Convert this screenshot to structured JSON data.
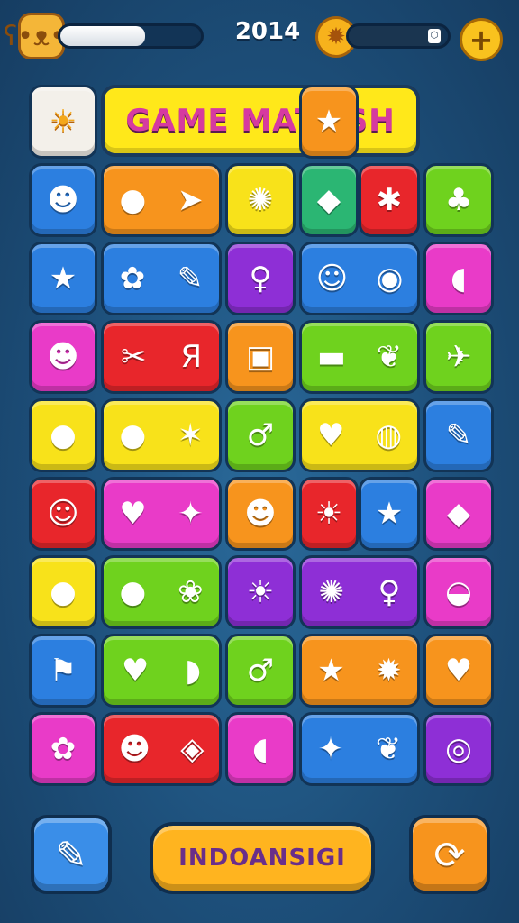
{
  "hud": {
    "score": "2014",
    "progress_left": 0.6,
    "progress_right": 0.95,
    "avatar_icon": "ʕ•ᴥ•ʔ",
    "coin_icon": "✹",
    "plus_label": "+"
  },
  "title": "GAME MATЦSH",
  "bottom": {
    "center_label": "INDOANSIGI",
    "left_icon": "✎",
    "right_icon": "⟳"
  },
  "colors": {
    "yellow": "#f8e21a",
    "orange": "#f7941d",
    "blue": "#2c7fe0",
    "green": "#6fd21e",
    "pink": "#e93bc8",
    "red": "#e8262b",
    "purple": "#8e2fd6",
    "white": "#f3f0ea",
    "teal": "#2bb673"
  },
  "tiles": [
    {
      "row": 0,
      "c": 0,
      "span": 1,
      "color": "white",
      "icons": [
        "☀"
      ]
    },
    {
      "row": 0,
      "c": 4,
      "span": 1,
      "color": "orange",
      "icons": [
        "★"
      ]
    },
    {
      "row": 1,
      "c": 0,
      "span": 1,
      "color": "blue",
      "icons": [
        "☻"
      ]
    },
    {
      "row": 1,
      "c": 1,
      "span": 2,
      "color": "orange",
      "icons": [
        "●",
        "➤"
      ]
    },
    {
      "row": 1,
      "c": 3,
      "span": 1,
      "color": "yellow",
      "icons": [
        "✺"
      ]
    },
    {
      "row": 1,
      "c": 4,
      "span": 1,
      "color": "teal",
      "icons": [
        "◆"
      ]
    },
    {
      "row": 1,
      "c": 5,
      "span": 1,
      "color": "red",
      "icons": [
        "✱"
      ]
    },
    {
      "row": 1,
      "c": 6,
      "span": 1,
      "color": "green",
      "icons": [
        "♣"
      ]
    },
    {
      "row": 2,
      "c": 0,
      "span": 1,
      "color": "blue",
      "icons": [
        "★"
      ]
    },
    {
      "row": 2,
      "c": 1,
      "span": 2,
      "color": "blue",
      "icons": [
        "✿",
        "✎"
      ]
    },
    {
      "row": 2,
      "c": 3,
      "span": 1,
      "color": "purple",
      "icons": [
        "♀"
      ]
    },
    {
      "row": 2,
      "c": 4,
      "span": 2,
      "color": "blue",
      "icons": [
        "☺",
        "◉"
      ]
    },
    {
      "row": 2,
      "c": 6,
      "span": 1,
      "color": "pink",
      "icons": [
        "◖"
      ]
    },
    {
      "row": 3,
      "c": 0,
      "span": 1,
      "color": "pink",
      "icons": [
        "☻"
      ]
    },
    {
      "row": 3,
      "c": 1,
      "span": 2,
      "color": "red",
      "icons": [
        "✂",
        "Я"
      ]
    },
    {
      "row": 3,
      "c": 3,
      "span": 1,
      "color": "orange",
      "icons": [
        "▣"
      ]
    },
    {
      "row": 3,
      "c": 4,
      "span": 2,
      "color": "green",
      "icons": [
        "▬",
        "❦"
      ]
    },
    {
      "row": 3,
      "c": 6,
      "span": 1,
      "color": "green",
      "icons": [
        "✈"
      ]
    },
    {
      "row": 4,
      "c": 0,
      "span": 1,
      "color": "yellow",
      "icons": [
        "●"
      ]
    },
    {
      "row": 4,
      "c": 1,
      "span": 2,
      "color": "yellow",
      "icons": [
        "●",
        "✶"
      ]
    },
    {
      "row": 4,
      "c": 3,
      "span": 1,
      "color": "green",
      "icons": [
        "♂"
      ]
    },
    {
      "row": 4,
      "c": 4,
      "span": 2,
      "color": "yellow",
      "icons": [
        "♥",
        "◍"
      ]
    },
    {
      "row": 4,
      "c": 6,
      "span": 1,
      "color": "blue",
      "icons": [
        "✎"
      ]
    },
    {
      "row": 5,
      "c": 0,
      "span": 1,
      "color": "red",
      "icons": [
        "☺"
      ]
    },
    {
      "row": 5,
      "c": 1,
      "span": 2,
      "color": "pink",
      "icons": [
        "♥",
        "✦"
      ]
    },
    {
      "row": 5,
      "c": 3,
      "span": 1,
      "color": "orange",
      "icons": [
        "☻"
      ]
    },
    {
      "row": 5,
      "c": 4,
      "span": 1,
      "color": "red",
      "icons": [
        "☀"
      ]
    },
    {
      "row": 5,
      "c": 5,
      "span": 1,
      "color": "blue",
      "icons": [
        "★"
      ]
    },
    {
      "row": 5,
      "c": 6,
      "span": 1,
      "color": "pink",
      "icons": [
        "◆"
      ]
    },
    {
      "row": 6,
      "c": 0,
      "span": 1,
      "color": "yellow",
      "icons": [
        "●"
      ]
    },
    {
      "row": 6,
      "c": 1,
      "span": 2,
      "color": "green",
      "icons": [
        "●",
        "❀"
      ]
    },
    {
      "row": 6,
      "c": 3,
      "span": 1,
      "color": "purple",
      "icons": [
        "☀"
      ]
    },
    {
      "row": 6,
      "c": 4,
      "span": 2,
      "color": "purple",
      "icons": [
        "✺",
        "♀"
      ]
    },
    {
      "row": 6,
      "c": 6,
      "span": 1,
      "color": "pink",
      "icons": [
        "◒"
      ]
    },
    {
      "row": 7,
      "c": 0,
      "span": 1,
      "color": "blue",
      "icons": [
        "⚑"
      ]
    },
    {
      "row": 7,
      "c": 1,
      "span": 2,
      "color": "green",
      "icons": [
        "♥",
        "◗"
      ]
    },
    {
      "row": 7,
      "c": 3,
      "span": 1,
      "color": "green",
      "icons": [
        "♂"
      ]
    },
    {
      "row": 7,
      "c": 4,
      "span": 2,
      "color": "orange",
      "icons": [
        "★",
        "✹"
      ]
    },
    {
      "row": 7,
      "c": 6,
      "span": 1,
      "color": "orange",
      "icons": [
        "♥"
      ]
    },
    {
      "row": 8,
      "c": 0,
      "span": 1,
      "color": "pink",
      "icons": [
        "✿"
      ]
    },
    {
      "row": 8,
      "c": 1,
      "span": 2,
      "color": "red",
      "icons": [
        "☻",
        "◈"
      ]
    },
    {
      "row": 8,
      "c": 3,
      "span": 1,
      "color": "pink",
      "icons": [
        "◖"
      ]
    },
    {
      "row": 8,
      "c": 4,
      "span": 2,
      "color": "blue",
      "icons": [
        "✦",
        "❦"
      ]
    },
    {
      "row": 8,
      "c": 6,
      "span": 1,
      "color": "purple",
      "icons": [
        "◎"
      ]
    }
  ]
}
